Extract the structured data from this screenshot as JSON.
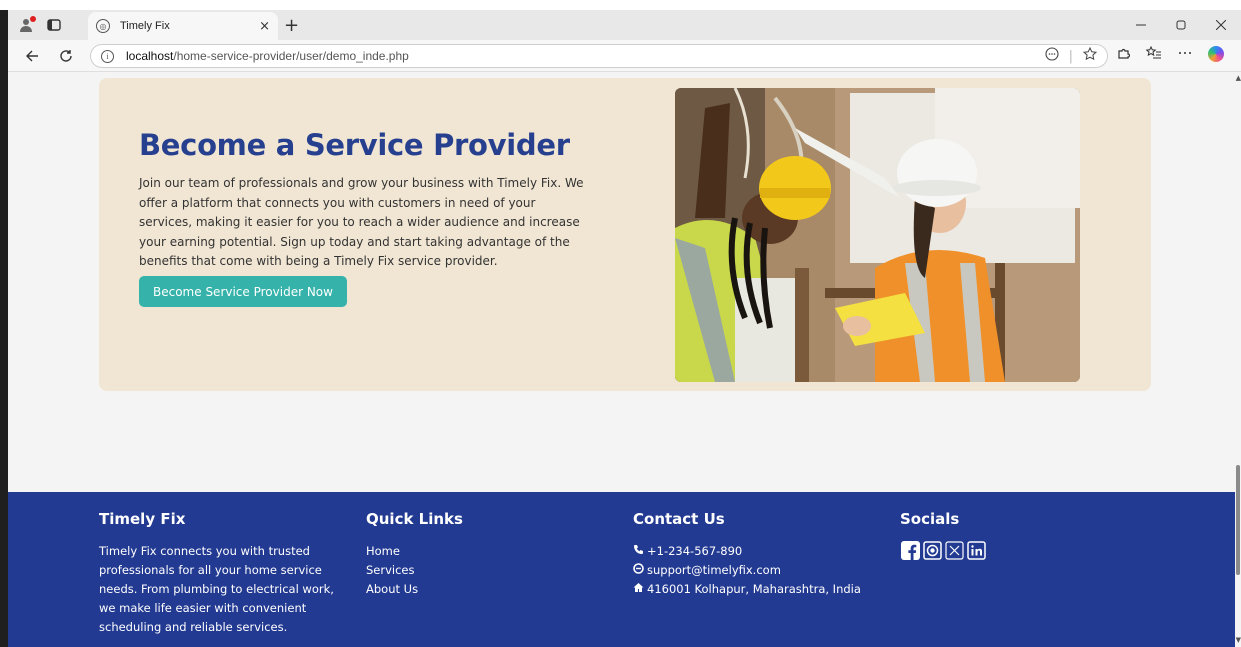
{
  "browser": {
    "tab_title": "Timely Fix",
    "tab_close": "×",
    "new_tab": "+",
    "url_host": "localhost",
    "url_path": "/home-service-provider/user/demo_inde.php"
  },
  "hero": {
    "title": "Become a Service Provider",
    "description": "Join our team of professionals and grow your business with Timely Fix. We offer a platform that connects you with customers in need of your services, making it easier for you to reach a wider audience and increase your earning potential. Sign up today and start taking advantage of the benefits that come with being a Timely Fix service provider.",
    "button_label": "Become Service Provider Now"
  },
  "footer": {
    "about": {
      "heading": "Timely Fix",
      "text": "Timely Fix connects you with trusted professionals for all your home service needs. From plumbing to electrical work, we make life easier with convenient scheduling and reliable services."
    },
    "quick_links": {
      "heading": "Quick Links",
      "items": [
        "Home",
        "Services",
        "About Us"
      ]
    },
    "contact": {
      "heading": "Contact Us",
      "phone": "+1-234-567-890",
      "email": "support@timelyfix.com",
      "address": "416001 Kolhapur, Maharashtra, India"
    },
    "socials": {
      "heading": "Socials",
      "icons": [
        "facebook-icon",
        "instagram-icon",
        "x-icon",
        "linkedin-icon"
      ]
    }
  },
  "colors": {
    "hero_bg": "#f1e6d4",
    "title": "#26408f",
    "button": "#35b3aa",
    "footer_bg": "#233a92"
  }
}
